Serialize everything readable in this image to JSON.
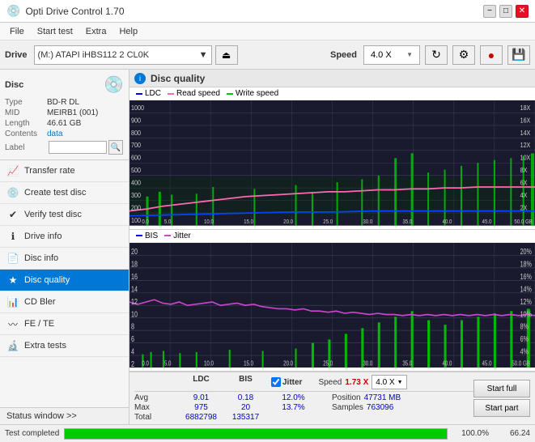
{
  "titleBar": {
    "title": "Opti Drive Control 1.70",
    "icon": "●",
    "minimize": "−",
    "maximize": "□",
    "close": "✕"
  },
  "menuBar": {
    "items": [
      "File",
      "Start test",
      "Extra",
      "Help"
    ]
  },
  "toolbar": {
    "driveLabel": "Drive",
    "driveValue": "(M:) ATAPI iHBS112  2 CL0K",
    "speedLabel": "Speed",
    "speedValue": "4.0 X"
  },
  "disc": {
    "title": "Disc",
    "type": {
      "label": "Type",
      "value": "BD-R DL"
    },
    "mid": {
      "label": "MID",
      "value": "MEIRB1 (001)"
    },
    "length": {
      "label": "Length",
      "value": "46.61 GB"
    },
    "contents": {
      "label": "Contents",
      "value": "data"
    },
    "label": {
      "label": "Label",
      "placeholder": ""
    }
  },
  "nav": {
    "items": [
      {
        "id": "transfer-rate",
        "label": "Transfer rate",
        "icon": "📈",
        "active": false
      },
      {
        "id": "create-test-disc",
        "label": "Create test disc",
        "icon": "💿",
        "active": false
      },
      {
        "id": "verify-test-disc",
        "label": "Verify test disc",
        "icon": "✔",
        "active": false
      },
      {
        "id": "drive-info",
        "label": "Drive info",
        "icon": "ℹ",
        "active": false
      },
      {
        "id": "disc-info",
        "label": "Disc info",
        "icon": "📄",
        "active": false
      },
      {
        "id": "disc-quality",
        "label": "Disc quality",
        "icon": "★",
        "active": true
      },
      {
        "id": "cd-bler",
        "label": "CD Bler",
        "icon": "📊",
        "active": false
      },
      {
        "id": "fe-te",
        "label": "FE / TE",
        "icon": "〰",
        "active": false
      },
      {
        "id": "extra-tests",
        "label": "Extra tests",
        "icon": "🔬",
        "active": false
      }
    ],
    "statusWindow": "Status window >>"
  },
  "chartPanel": {
    "title": "Disc quality",
    "topChart": {
      "legend": {
        "ldc": "LDC",
        "read": "Read speed",
        "write": "Write speed"
      },
      "yAxisMax": 1000,
      "yAxisRight": 18,
      "xAxisMax": 50
    },
    "bottomChart": {
      "legend": {
        "bis": "BIS",
        "jitter": "Jitter"
      },
      "yAxisMax": 20,
      "yAxisRight": 20,
      "xAxisMax": 50
    }
  },
  "stats": {
    "columns": [
      "LDC",
      "BIS",
      "Jitter"
    ],
    "avg": {
      "ldc": "9.01",
      "bis": "0.18",
      "jitter": "12.0%"
    },
    "max": {
      "ldc": "975",
      "bis": "20",
      "jitter": "13.7%"
    },
    "total": {
      "ldc": "6882798",
      "bis": "135317"
    },
    "jitterChecked": true,
    "speed": {
      "label": "Speed",
      "value": "1.73 X",
      "comboValue": "4.0 X"
    },
    "position": {
      "label": "Position",
      "value": "47731 MB"
    },
    "samples": {
      "label": "Samples",
      "value": "763096"
    },
    "buttons": {
      "startFull": "Start full",
      "startPart": "Start part"
    }
  },
  "statusBar": {
    "text": "Test completed",
    "progress": 100,
    "progressLabel": "100.0%",
    "rightValue": "66.24"
  }
}
